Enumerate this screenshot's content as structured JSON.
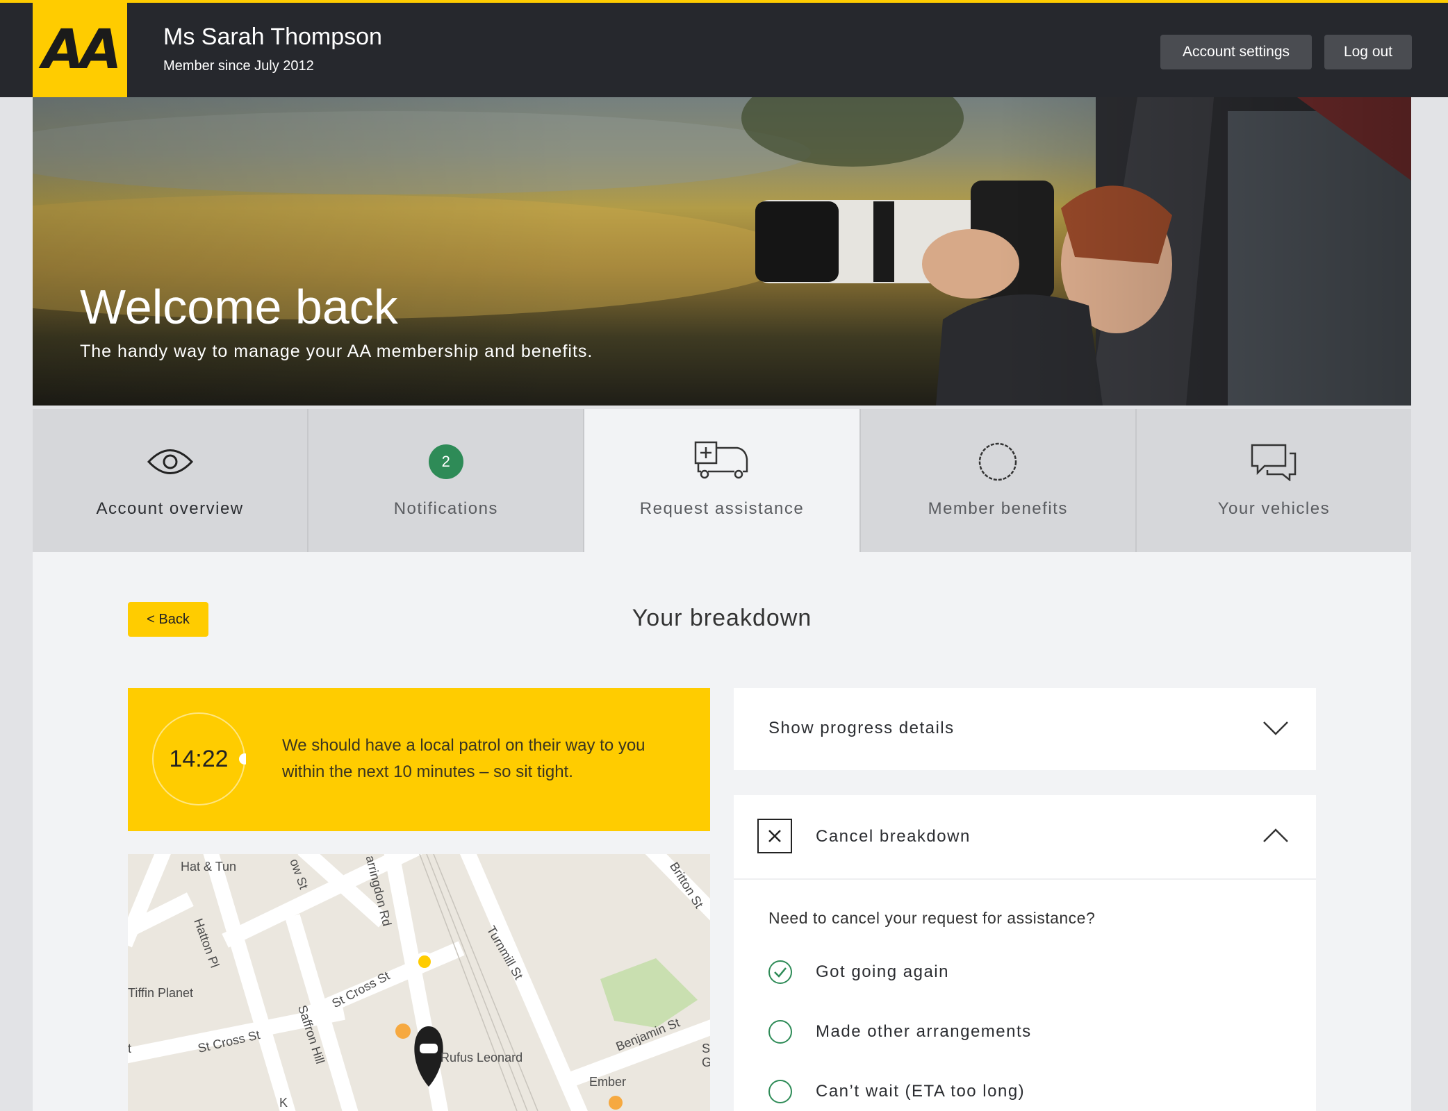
{
  "header": {
    "logo_text": "AA",
    "user_name": "Ms Sarah Thompson",
    "member_since": "Member since July 2012",
    "account_settings_label": "Account settings",
    "logout_label": "Log out"
  },
  "hero": {
    "title": "Welcome back",
    "subtitle": "The handy way to manage your AA membership and benefits."
  },
  "tabs": [
    {
      "label": "Account overview",
      "icon": "eye-icon",
      "active": false
    },
    {
      "label": "Notifications",
      "icon": "notification-badge",
      "badge": "2",
      "active": false
    },
    {
      "label": "Request assistance",
      "icon": "car-plus-icon",
      "active": true
    },
    {
      "label": "Member benefits",
      "icon": "rosette-icon",
      "active": false
    },
    {
      "label": "Your vehicles",
      "icon": "chat-bubbles-icon",
      "active": false
    }
  ],
  "page": {
    "back_label": "< Back",
    "title": "Your breakdown"
  },
  "eta": {
    "time": "14:22",
    "message": "We should have a local patrol on their way to you within the next 10 minutes – so sit tight."
  },
  "map": {
    "labels": [
      "Hat & Tun",
      "Hatton Pl",
      "ow St",
      "arringdon Rd",
      "Britton St",
      "Turnmill St",
      "Tiffin Planet",
      "St Cross St",
      "St Cross St",
      "Saffron Hill",
      "Rufus Leonard",
      "Benjamin St",
      "Ember",
      "S",
      "G",
      "t",
      "K"
    ]
  },
  "progress_panel": {
    "label": "Show progress details"
  },
  "cancel_panel": {
    "title": "Cancel breakdown",
    "question": "Need to cancel your request for assistance?",
    "options": [
      {
        "label": "Got going again",
        "checked": true
      },
      {
        "label": "Made other arrangements",
        "checked": false
      },
      {
        "label": "Can’t wait (ETA too long)",
        "checked": false
      }
    ]
  },
  "colors": {
    "brand_yellow": "#ffcc00",
    "header_dark": "#26282d",
    "accent_green": "#2e8b57"
  }
}
